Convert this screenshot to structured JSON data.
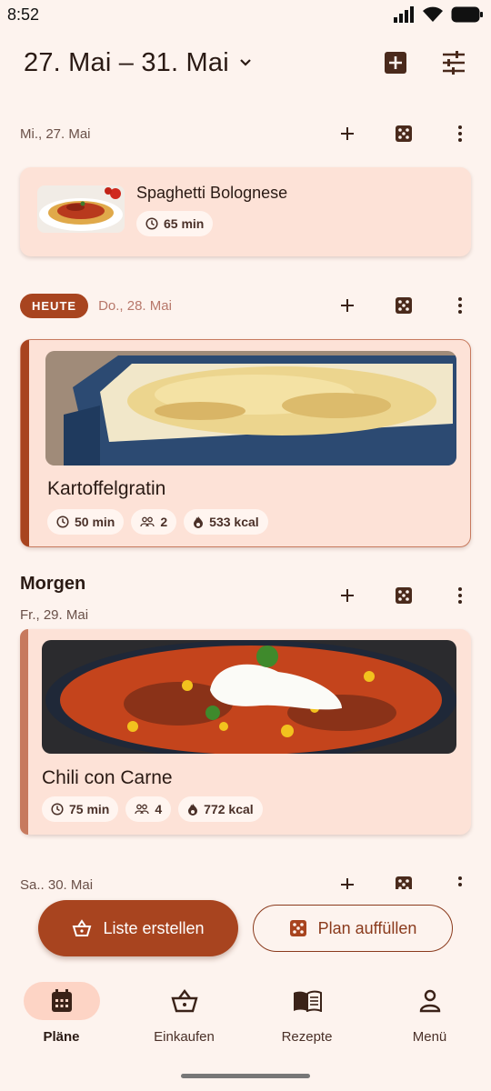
{
  "status": {
    "time": "8:52"
  },
  "header": {
    "range": "27. Mai – 31. Mai"
  },
  "days": [
    {
      "label": "Mi., 27. Mai"
    },
    {
      "badge": "HEUTE",
      "label": "Do., 28. Mai"
    },
    {
      "heading": "Morgen",
      "label": "Fr., 29. Mai"
    },
    {
      "label": "Sa., 30. Mai"
    }
  ],
  "meals": [
    {
      "title": "Spaghetti Bolognese",
      "time": "65 min"
    },
    {
      "title": "Kartoffelgratin",
      "time": "50 min",
      "servings": "2",
      "kcal": "533 kcal"
    },
    {
      "title": "Chili con Carne",
      "time": "75 min",
      "servings": "4",
      "kcal": "772 kcal"
    }
  ],
  "actions": {
    "create_list": "Liste erstellen",
    "fill_plan": "Plan auffüllen"
  },
  "nav": [
    {
      "label": "Pläne",
      "icon": "calendar-icon",
      "active": true
    },
    {
      "label": "Einkaufen",
      "icon": "basket-icon"
    },
    {
      "label": "Rezepte",
      "icon": "book-icon"
    },
    {
      "label": "Menü",
      "icon": "person-icon"
    }
  ],
  "colors": {
    "background": "#fdf3ee",
    "accent": "#a8441f",
    "card": "#fde2d7"
  }
}
